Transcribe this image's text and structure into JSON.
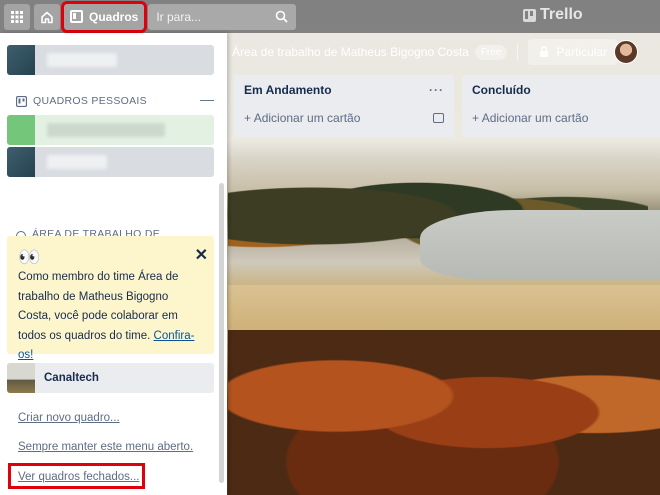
{
  "app": {
    "brand": "Trello",
    "colors": {
      "highlight": "#e0000b",
      "header": "#787878",
      "notice_bg": "#fdf6cd"
    }
  },
  "header": {
    "apps_icon": "apps-grid-icon",
    "home_icon": "home-icon",
    "boards_label": "Quadros",
    "search_placeholder": "Ir para...",
    "search_icon": "search-icon"
  },
  "board_header": {
    "workspace_name": "Área de trabalho de Matheus Bigogno Costa",
    "plan_badge": "Free",
    "visibility_label": "Particular"
  },
  "lists": [
    {
      "title": "Em Andamento",
      "add_card_label": "Adicionar um cartão",
      "menu_label": "···"
    },
    {
      "title": "Concluído",
      "add_card_label": "Adicionar um cartão"
    }
  ],
  "sidebar": {
    "personal_boards_heading": "QUADROS PESSOAIS",
    "collapse_symbol": "—",
    "workspace_heading": "ÁREA DE TRABALHO DE MATHEUS BIGOGNO COSTA",
    "notice": {
      "emoji": "👀",
      "text": "Como membro do time Área de trabalho de Matheus Bigogno Costa, você pode colaborar em todos os quadros do time.",
      "link": "Confira-os!",
      "close_symbol": "✕"
    },
    "team_board": "Canaltech",
    "links": {
      "create_board": "Criar novo quadro...",
      "keep_open": "Sempre manter este menu aberto.",
      "closed_boards": "Ver quadros fechados..."
    }
  }
}
